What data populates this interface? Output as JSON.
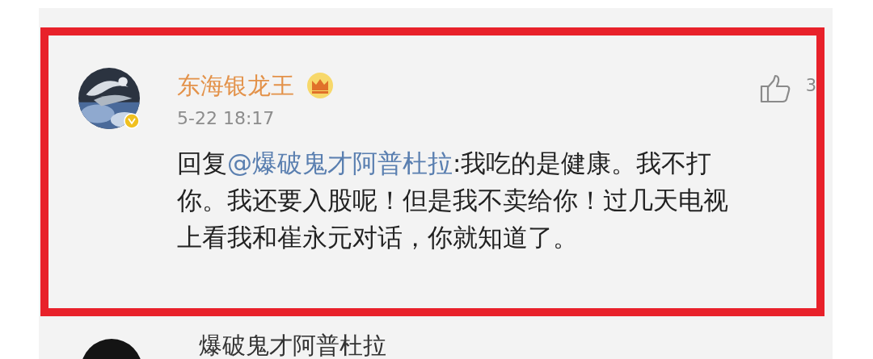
{
  "highlighted_comment": {
    "author": "东海银龙王",
    "vip": true,
    "verified": true,
    "time": "5-22 18:17",
    "likes": "3",
    "reply_prefix": "回复",
    "mention": "@爆破鬼才阿普杜拉",
    "text": ":我吃的是健康。我不打你。我还要入股呢！但是我不卖给你！过几天电视上看我和崔永元对话，你就知道了。"
  },
  "next_comment": {
    "author": "爆破鬼才阿普杜拉"
  }
}
